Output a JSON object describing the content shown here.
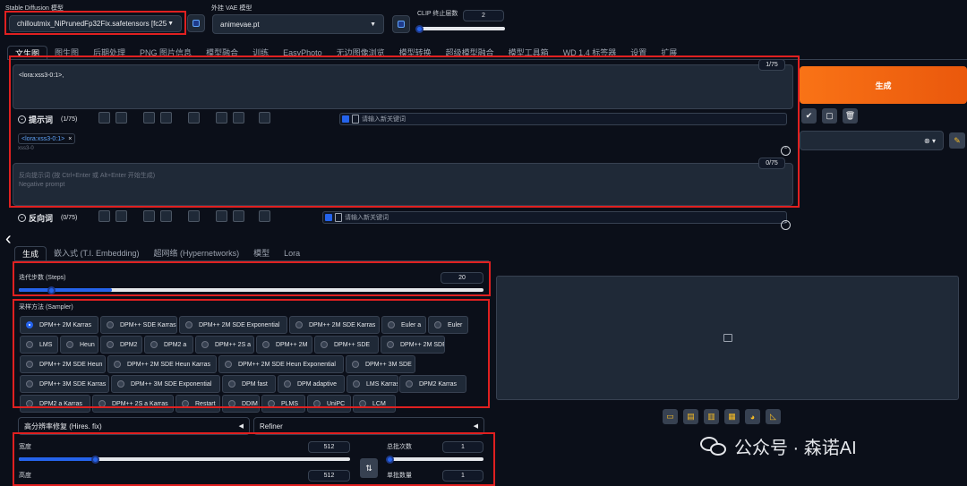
{
  "header": {
    "model_label": "Stable Diffusion 模型",
    "model_value": "chilloutmix_NiPrunedFp32Fix.safetensors [fc25",
    "vae_label": "外挂 VAE 模型",
    "vae_value": "animevae.pt",
    "clip_label": "CLIP 终止层数",
    "clip_value": "2"
  },
  "tabs": [
    "文生图",
    "图生图",
    "后期处理",
    "PNG 图片信息",
    "模型融合",
    "训练",
    "EasyPhoto",
    "无边图像浏览",
    "模型转换",
    "超级模型融合",
    "模型工具箱",
    "WD 1.4 标签器",
    "设置",
    "扩展"
  ],
  "prompt": {
    "text": "<lora:xss3-0:1>,",
    "counter": "1/75",
    "label": "提示词",
    "count": "(1/75)",
    "keyword_placeholder": "请输入新关键词",
    "tag": "<lora:xss3-0:1>",
    "tag_close": "×",
    "tag_sub": "xss3-0"
  },
  "negative": {
    "placeholder_line1": "反向提示词 (按 Ctrl+Enter 或 Alt+Enter 开始生成)",
    "placeholder_line2": "Negative prompt",
    "counter": "0/75",
    "label": "反向词",
    "count": "(0/75)",
    "keyword_placeholder": "请输入新关键词"
  },
  "generate_label": "生成",
  "subtabs": [
    "生成",
    "嵌入式 (T.I. Embedding)",
    "超网络 (Hypernetworks)",
    "模型",
    "Lora"
  ],
  "steps": {
    "label": "迭代步数 (Steps)",
    "value": "20",
    "fraction": 0.2
  },
  "sampler": {
    "label": "采样方法 (Sampler)",
    "selected": "DPM++ 2M Karras",
    "options": [
      "DPM++ 2M Karras",
      "DPM++ SDE Karras",
      "DPM++ 2M SDE Exponential",
      "DPM++ 2M SDE Karras",
      "Euler a",
      "Euler",
      "LMS",
      "Heun",
      "DPM2",
      "DPM2 a",
      "DPM++ 2S a",
      "DPM++ 2M",
      "DPM++ SDE",
      "DPM++ 2M SDE",
      "DPM++ 2M SDE Heun",
      "DPM++ 2M SDE Heun Karras",
      "DPM++ 2M SDE Heun Exponential",
      "DPM++ 3M SDE",
      "DPM++ 3M SDE Karras",
      "DPM++ 3M SDE Exponential",
      "DPM fast",
      "DPM adaptive",
      "LMS Karras",
      "DPM2 Karras",
      "DPM2 a Karras",
      "DPM++ 2S a Karras",
      "Restart",
      "DDIM",
      "PLMS",
      "UniPC",
      "LCM"
    ]
  },
  "hires_label": "高分辨率修复 (Hires. fix)",
  "refiner_label": "Refiner",
  "width": {
    "label": "宽度",
    "value": "512"
  },
  "height": {
    "label": "高度",
    "value": "512"
  },
  "batch_count": {
    "label": "总批次数",
    "value": "1"
  },
  "batch_size": {
    "label": "单批数量",
    "value": "1"
  },
  "watermark": "公众号 · 森诺AI",
  "colors": {
    "accent": "#f97316",
    "brand_blue": "#2563eb",
    "highlight_red": "#e02020"
  }
}
